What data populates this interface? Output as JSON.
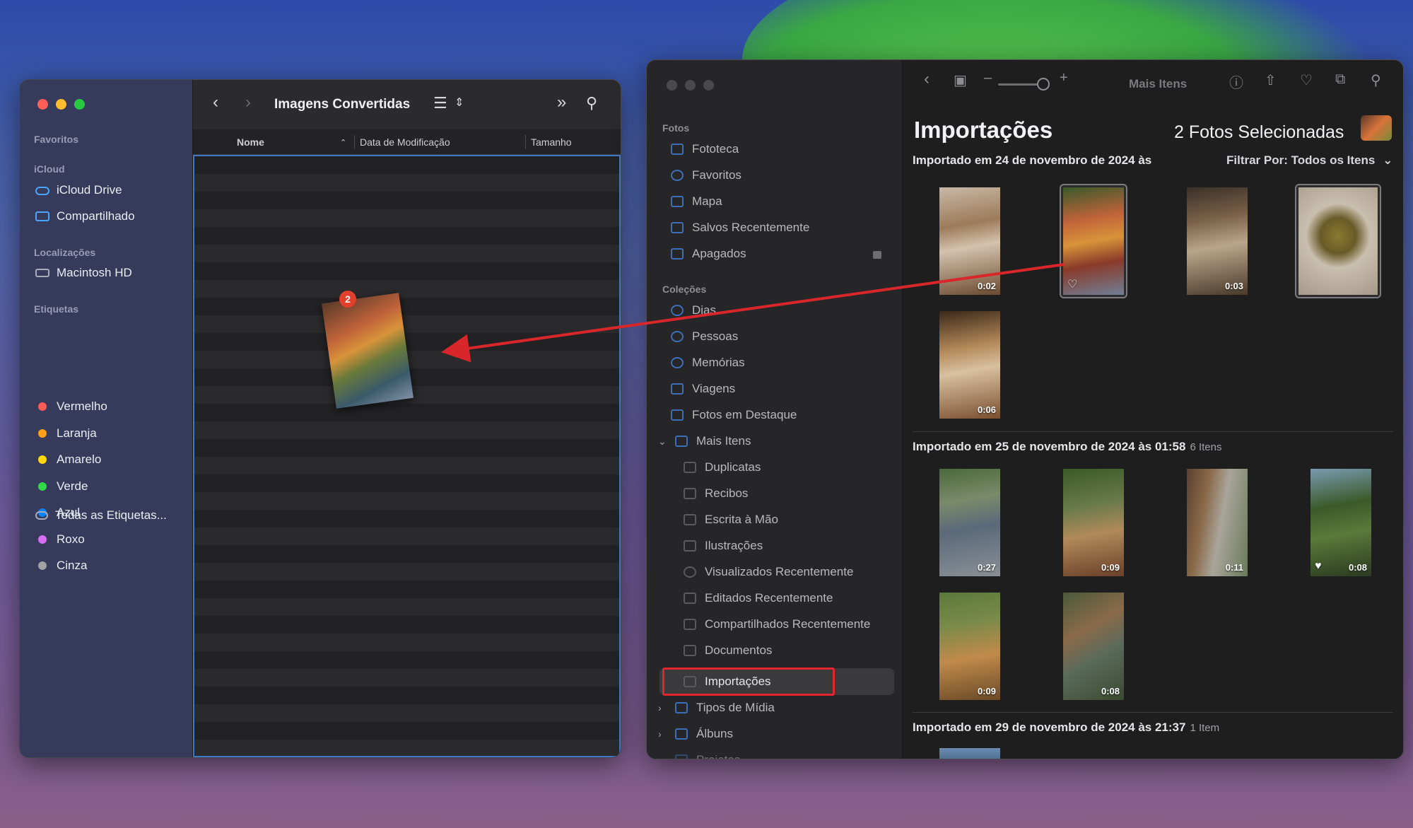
{
  "finder": {
    "title": "Imagens Convertidas",
    "sidebar": {
      "favorites": "Favoritos",
      "icloud": "iCloud",
      "icloud_drive": "iCloud Drive",
      "shared": "Compartilhado",
      "locations": "Localizações",
      "macintosh_hd": "Macintosh HD",
      "tags": "Etiquetas",
      "tag_items": [
        {
          "label": "Vermelho",
          "color": "#ff5b5b"
        },
        {
          "label": "Laranja",
          "color": "#ff9f1a"
        },
        {
          "label": "Amarelo",
          "color": "#ffd60a"
        },
        {
          "label": "Verde",
          "color": "#32d74b"
        },
        {
          "label": "Azul",
          "color": "#0a84ff"
        },
        {
          "label": "Roxo",
          "color": "#d66ef0"
        },
        {
          "label": "Cinza",
          "color": "#a0a0a5"
        }
      ],
      "all_tags": "Todas as Etiquetas..."
    },
    "columns": {
      "name": "Nome",
      "modified": "Data de Modificação",
      "size": "Tamanho"
    },
    "drag_badge": "2"
  },
  "photos": {
    "sidebar": {
      "section_photos": "Fotos",
      "library": "Fototeca",
      "favorites": "Favoritos",
      "map": "Mapa",
      "recently_saved": "Salvos Recentemente",
      "deleted": "Apagados",
      "section_collections": "Coleções",
      "days": "Dias",
      "people": "Pessoas",
      "memories": "Memórias",
      "trips": "Viagens",
      "featured": "Fotos em Destaque",
      "more_items": "Mais Itens",
      "duplicates": "Duplicatas",
      "receipts": "Recibos",
      "handwriting": "Escrita à Mão",
      "illustrations": "Ilustrações",
      "recently_viewed": "Visualizados Recentemente",
      "recently_edited": "Editados Recentemente",
      "recently_shared": "Compartilhados Recentemente",
      "documents": "Documentos",
      "imports": "Importações",
      "media_types": "Tipos de Mídia",
      "albums": "Álbuns",
      "projects": "Projetos"
    },
    "toolbar": {
      "more_items": "Mais Itens"
    },
    "title": "Importações",
    "selected_count": "2 Fotos Selecionadas",
    "filter": "Filtrar Por: Todos os Itens",
    "sections": [
      {
        "title": "Importado em 24 de novembro de 2024 às",
        "count": ""
      },
      {
        "title": "Importado em 25 de novembro de 2024 às 01:58",
        "count": "6 Itens"
      },
      {
        "title": "Importado em 29 de novembro de 2024 às 21:37",
        "count": "1 Item"
      }
    ],
    "durations": {
      "a1": "0:02",
      "a3": "0:03",
      "a5": "0:06",
      "b1": "0:27",
      "b2": "0:09",
      "b3": "0:11",
      "b4": "0:08",
      "b5": "0:09",
      "b6": "0:08"
    }
  },
  "colors": {
    "accent": "#0a84ff",
    "highlight": "#e3262a",
    "arrow": "#d8262a"
  }
}
